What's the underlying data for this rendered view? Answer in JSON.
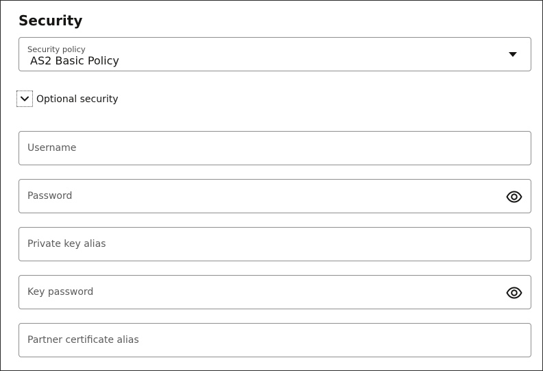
{
  "section": {
    "title": "Security"
  },
  "policy_select": {
    "label": "Security policy",
    "value": "AS2 Basic Policy",
    "icon": "caret-down-icon"
  },
  "optional_section": {
    "label": "Optional security",
    "expanded": true,
    "icon": "chevron-down-icon"
  },
  "fields": {
    "username": {
      "placeholder": "Username",
      "value": ""
    },
    "password": {
      "placeholder": "Password",
      "value": "",
      "icon": "eye-icon"
    },
    "private_key_alias": {
      "placeholder": "Private key alias",
      "value": ""
    },
    "key_password": {
      "placeholder": "Key password",
      "value": "",
      "icon": "eye-icon"
    },
    "partner_certificate_alias": {
      "placeholder": "Partner certificate alias",
      "value": ""
    }
  }
}
